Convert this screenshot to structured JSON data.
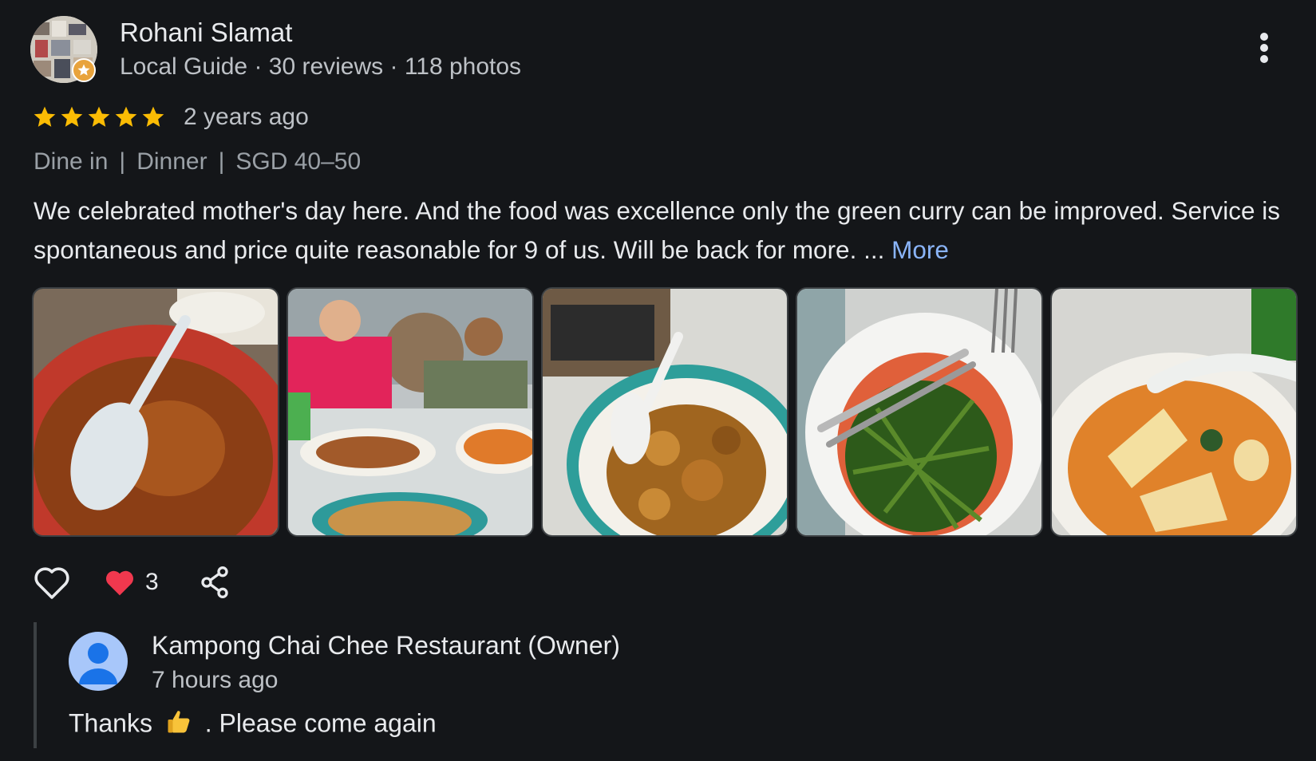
{
  "review": {
    "reviewer": {
      "name": "Rohani Slamat",
      "meta": "Local Guide · 30 reviews · 118 photos",
      "badge_icon": "local-guide-star-icon"
    },
    "rating": 5,
    "rating_max": 5,
    "time": "2 years ago",
    "tags": [
      "Dine in",
      "Dinner",
      "SGD 40–50"
    ],
    "text": "We celebrated mother's day here. And the food was excellence only the green curry can be improved. Service is spontaneous and price quite reasonable for 9 of us. Will be back for more. ... ",
    "more_label": "More",
    "photos": [
      {
        "subject": "curry-dish-photo"
      },
      {
        "subject": "diners-table-photo"
      },
      {
        "subject": "fried-dish-photo"
      },
      {
        "subject": "kangkung-vegetable-photo"
      },
      {
        "subject": "curry-soup-photo"
      }
    ],
    "actions": {
      "like_icon": "heart-outline-icon",
      "reaction_icon": "red-heart-icon",
      "reaction_count": "3",
      "share_icon": "share-icon"
    }
  },
  "owner_reply": {
    "name": "Kampong Chai Chee Restaurant (Owner)",
    "time": "7 hours ago",
    "text_before": "Thanks",
    "text_after": ". Please come again",
    "emoji": "thumbs-up-icon"
  },
  "colors": {
    "background": "#141619",
    "star": "#fbbc04",
    "link": "#8ab4f8",
    "owner_avatar": "#a8c7fa",
    "owner_avatar_figure": "#1a73e8"
  }
}
